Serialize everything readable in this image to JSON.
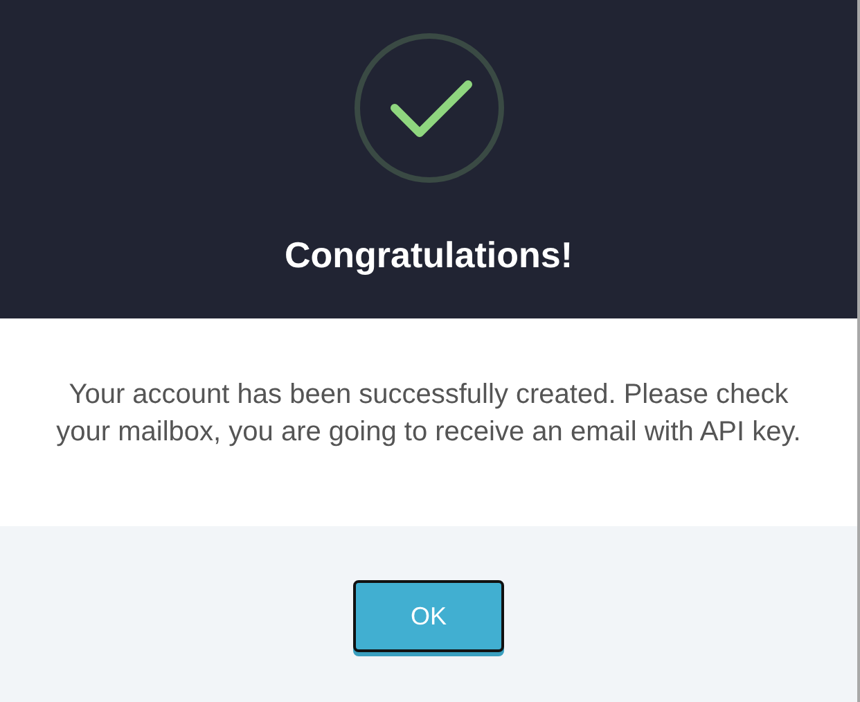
{
  "dialog": {
    "title": "Congratulations!",
    "message": "Your account has been successfully created. Please check your mailbox, you are going to receive an email with API key.",
    "buttons": [
      "OK"
    ]
  }
}
